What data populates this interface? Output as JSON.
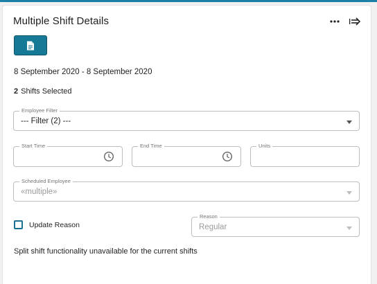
{
  "panel": {
    "title": "Multiple Shift Details",
    "actions": {
      "more_icon": "more-horizontal-icon",
      "collapse_icon": "arrow-right-bar-icon",
      "document_icon": "document-icon"
    },
    "date_range": "8 September 2020 - 8 September 2020",
    "shifts_selected": {
      "count": "2",
      "label": "Shifts Selected"
    },
    "employee_filter": {
      "label": "Employee Filter",
      "value": "--- Filter (2) ---"
    },
    "start_time": {
      "label": "Start Time",
      "value": ""
    },
    "end_time": {
      "label": "End Time",
      "value": ""
    },
    "units": {
      "label": "Units",
      "value": ""
    },
    "scheduled_employee": {
      "label": "Scheduled Employee",
      "value": "«multiple»"
    },
    "update_reason": {
      "label": "Update Reason",
      "checked": false
    },
    "reason": {
      "label": "Reason",
      "value": "Regular"
    },
    "split_message": "Split shift functionality unavailable for the current shifts"
  },
  "colors": {
    "accent": "#167a96",
    "top_strip": "#1b7fa6",
    "checkbox_border": "#1b6f92"
  }
}
